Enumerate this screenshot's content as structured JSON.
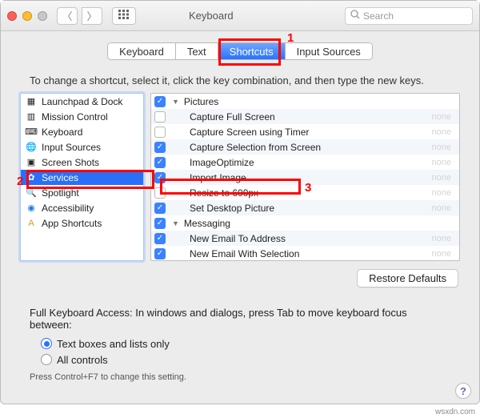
{
  "window": {
    "title": "Keyboard",
    "search_placeholder": "Search"
  },
  "tabs": {
    "items": [
      "Keyboard",
      "Text",
      "Shortcuts",
      "Input Sources"
    ],
    "selected_index": 2
  },
  "annotations": {
    "n1": "1",
    "n2": "2",
    "n3": "3"
  },
  "instruction": "To change a shortcut, select it, click the key combination, and then type the new keys.",
  "sidebar": {
    "items": [
      {
        "label": "Launchpad & Dock",
        "icon": "launchpad-icon"
      },
      {
        "label": "Mission Control",
        "icon": "mission-control-icon"
      },
      {
        "label": "Keyboard",
        "icon": "keyboard-icon"
      },
      {
        "label": "Input Sources",
        "icon": "globe-icon"
      },
      {
        "label": "Screen Shots",
        "icon": "screenshot-icon"
      },
      {
        "label": "Services",
        "icon": "gear-icon"
      },
      {
        "label": "Spotlight",
        "icon": "spotlight-icon"
      },
      {
        "label": "Accessibility",
        "icon": "accessibility-icon"
      },
      {
        "label": "App Shortcuts",
        "icon": "app-shortcuts-icon"
      }
    ],
    "selected_index": 5
  },
  "services": {
    "group0": {
      "label": "Pictures"
    },
    "rows": [
      {
        "checked": false,
        "label": "Capture Full Screen",
        "shortcut": "none"
      },
      {
        "checked": false,
        "label": "Capture Screen using Timer",
        "shortcut": "none"
      },
      {
        "checked": true,
        "label": "Capture Selection from Screen",
        "shortcut": "none"
      },
      {
        "checked": true,
        "label": "ImageOptimize",
        "shortcut": "none"
      },
      {
        "checked": true,
        "label": "Import Image",
        "shortcut": "none"
      },
      {
        "checked": false,
        "label": "Resize to 600px",
        "shortcut": "none"
      },
      {
        "checked": true,
        "label": "Set Desktop Picture",
        "shortcut": "none"
      }
    ],
    "group1": {
      "label": "Messaging"
    },
    "rows2": [
      {
        "checked": true,
        "label": "New Email To Address",
        "shortcut": "none"
      },
      {
        "checked": true,
        "label": "New Email With Selection",
        "shortcut": "none"
      }
    ]
  },
  "buttons": {
    "restore": "Restore Defaults"
  },
  "fka": {
    "text": "Full Keyboard Access: In windows and dialogs, press Tab to move keyboard focus between:",
    "opt1": "Text boxes and lists only",
    "opt2": "All controls",
    "selected": 0,
    "hint": "Press Control+F7 to change this setting."
  },
  "help": "?",
  "watermark": "wsxdn.com"
}
